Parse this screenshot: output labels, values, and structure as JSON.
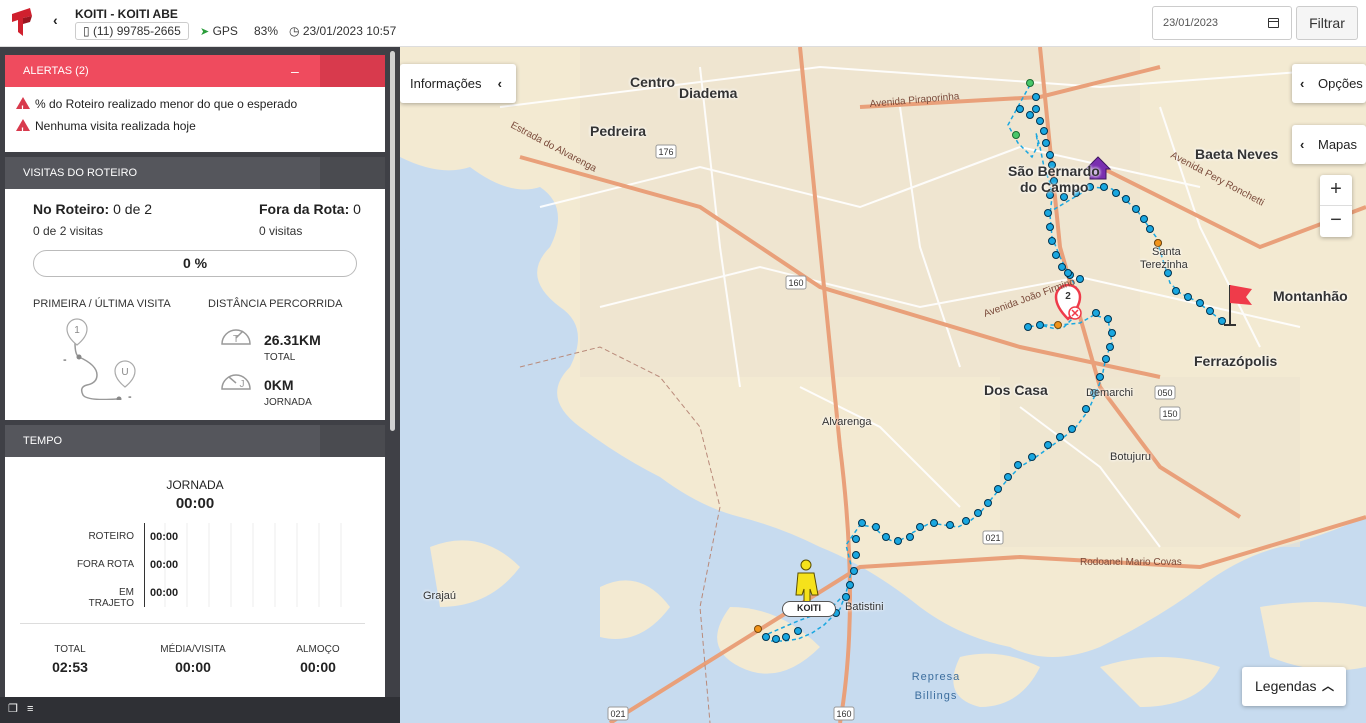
{
  "header": {
    "device_name": "KOITI - KOITI ABE",
    "phone": "(11) 99785-2665",
    "gps_label": "GPS",
    "battery": "83%",
    "datetime": "23/01/2023 10:57",
    "date_filter_value": "23/01/2023",
    "filter_button": "Filtrar"
  },
  "alerts": {
    "title": "ALERTAS (2)",
    "collapse": "–",
    "items": [
      "% do Roteiro realizado menor do que o esperado",
      "Nenhuma visita realizada hoje"
    ]
  },
  "visits": {
    "title": "VISITAS DO ROTEIRO",
    "no_roteiro_label": "No Roteiro:",
    "no_roteiro_value": "0 de 2",
    "fora_rota_label": "Fora da Rota:",
    "fora_rota_value": "0",
    "no_roteiro_sub": "0 de 2 visitas",
    "fora_rota_sub": "0 visitas",
    "progress_text": "0 %",
    "progress_fraction": 0,
    "first_last_caption": "PRIMEIRA / ÚLTIMA VISITA",
    "first_dash": "-",
    "last_dash": "-",
    "distance_caption": "DISTÂNCIA PERCORRIDA",
    "total_km": "26.31KM",
    "total_label": "TOTAL",
    "jornada_km": "0KM",
    "jornada_label": "JORNADA"
  },
  "time": {
    "title": "TEMPO",
    "jornada_label": "JORNADA",
    "jornada_value": "00:00",
    "rows": [
      {
        "label": "ROTEIRO",
        "value": "00:00"
      },
      {
        "label": "FORA ROTA",
        "value": "00:00"
      },
      {
        "label": "EM TRAJETO",
        "value": "00:00"
      }
    ],
    "total_label": "TOTAL",
    "total_value": "02:53",
    "media_label": "MÉDIA/VISITA",
    "media_value": "00:00",
    "almoco_label": "ALMOÇO",
    "almoco_value": "00:00"
  },
  "map": {
    "informacoes": "Informações",
    "opcoes": "Opções",
    "mapas": "Mapas",
    "zoom_in": "+",
    "zoom_out": "−",
    "legendas": "Legendas",
    "user_tag": "KOITI",
    "marker_number": "2",
    "places": {
      "centro": "Centro",
      "diadema": "Diadema",
      "pedreira": "Pedreira",
      "sao_bernardo_1": "São Bernardo",
      "sao_bernardo_2": "do Campo",
      "baeta_neves": "Baeta Neves",
      "montanhao": "Montanhão",
      "ferrazopolis": "Ferrazópolis",
      "dos_casa": "Dos Casa",
      "demarchi": "Demarchi",
      "alvarenga": "Alvarenga",
      "botujuru": "Botujuru",
      "santa_terezinha_1": "Santa",
      "santa_terezinha_2": "Terezinha",
      "grajau": "Grajaú",
      "batistini": "Batistini",
      "represa_1": "Represa",
      "represa_2": "Billings"
    },
    "roads": {
      "r176": "176",
      "r160a": "160",
      "r160b": "160",
      "r050": "050",
      "r150": "150",
      "r021a": "021",
      "r021b": "021",
      "rodoanel": "Rodoanel Mario Covas",
      "estrada_alvarenga": "Estrada do Alvarenga",
      "av_joao_firmino": "Avenida João Firmino",
      "av_piraporinha": "Avenida Piraporinha",
      "av_pery_ronchetti": "Avenida Pery Ronchetti"
    },
    "colors": {
      "route": "#1aa7e0",
      "water": "#c7dbef",
      "land": "#f3ead2",
      "major_road": "#e9a07a",
      "alert": "#ef4b5e"
    }
  }
}
